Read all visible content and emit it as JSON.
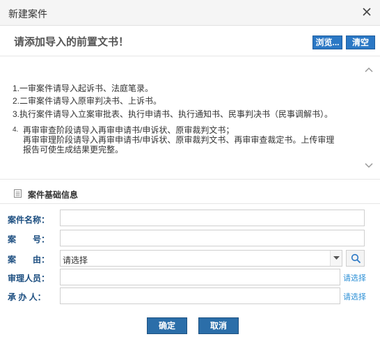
{
  "dialog": {
    "title": "新建案件"
  },
  "upload": {
    "heading": "请添加导入的前置文书！",
    "browse_label": "浏览...",
    "clear_label": "清空"
  },
  "notes": {
    "items": [
      "1.一审案件请导入起诉书、法庭笔录。",
      "2.二审案件请导入原审判决书、上诉书。",
      "3.执行案件请导入立案审批表、执行申请书、执行通知书、民事判决书（民事调解书）。"
    ],
    "item4_number": "4.",
    "item4_lines": [
      "再审审查阶段请导入再审申请书/申诉状、原审裁判文书；",
      "再审审理阶段请导入再审申请书/申诉状、原审裁判文书、再审审查裁定书。上传审理",
      "报告可使生成结果更完整。"
    ]
  },
  "section": {
    "title": "案件基础信息"
  },
  "form": {
    "case_name_label": "案件名称：",
    "case_number_label": "案　　号：",
    "cause_label": "案　　由：",
    "cause_value": "请选择",
    "judges_label": "审理人员：",
    "handler_label": "承 办 人：",
    "select_link": "请选择"
  },
  "footer": {
    "ok_label": "确定",
    "cancel_label": "取消"
  },
  "colors": {
    "accent": "#2b78c5",
    "label": "#1c4e80",
    "link": "#2b8fd6"
  }
}
